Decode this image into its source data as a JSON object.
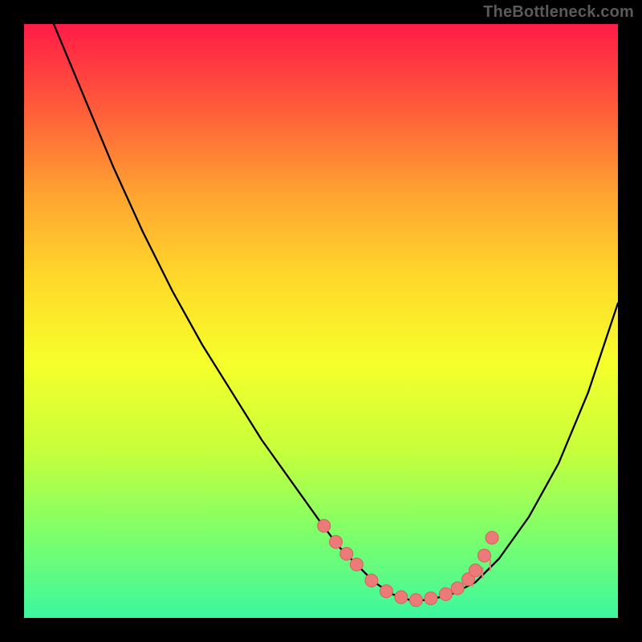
{
  "attribution": "TheBottleneck.com",
  "colors": {
    "gradient": [
      "#ff1c47",
      "#ff5c3a",
      "#ffa331",
      "#ffd92a",
      "#f6ff2b",
      "#c8ff3a",
      "#7fff6a",
      "#3cf79f"
    ],
    "curve": "#000000",
    "dot_fill": "#ec7a78",
    "dot_stroke": "#d85f5d",
    "bg": "#000000"
  },
  "dot_radius": 8,
  "chart_data": {
    "type": "line",
    "title": "",
    "xlabel": "",
    "ylabel": "",
    "xlim": [
      0,
      100
    ],
    "ylim": [
      0,
      100
    ],
    "grid": false,
    "legend": false,
    "series": [
      {
        "name": "bottleneck-curve",
        "x": [
          5,
          10,
          15,
          20,
          25,
          30,
          35,
          40,
          45,
          50,
          53,
          56,
          59,
          62,
          65,
          68,
          72,
          76,
          80,
          85,
          90,
          95,
          100
        ],
        "y": [
          100,
          88,
          76,
          65,
          55,
          46,
          38,
          30,
          23,
          16,
          12,
          9,
          6,
          4,
          3,
          3,
          4,
          6,
          10,
          17,
          26,
          38,
          53
        ]
      }
    ],
    "markers": {
      "name": "highlighted-points",
      "x": [
        50.5,
        52.5,
        54.3,
        56.0,
        58.5,
        61.0,
        63.5,
        66.0,
        68.5,
        71.0,
        73.0,
        74.8,
        76.0,
        77.5,
        78.8
      ],
      "y": [
        15.5,
        12.8,
        10.8,
        9.0,
        6.3,
        4.5,
        3.5,
        3.0,
        3.3,
        4.0,
        5.0,
        6.5,
        8.0,
        10.5,
        13.5
      ]
    }
  }
}
